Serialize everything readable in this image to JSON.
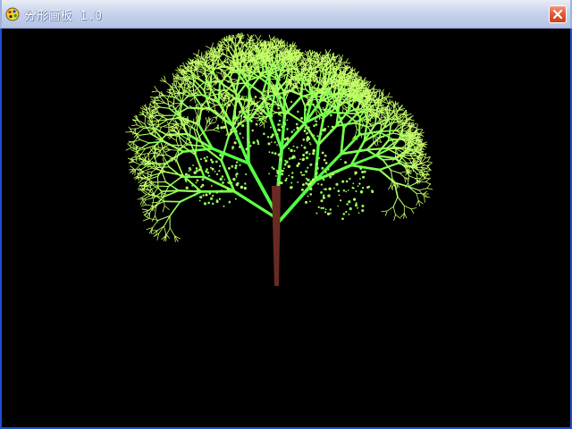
{
  "window": {
    "title": "分形画板 1.0",
    "background_color": "#000000"
  },
  "titlebar": {
    "app_icon": "paint-palette-icon",
    "close_icon": "close-icon"
  },
  "canvas": {
    "content": "fractal-tree",
    "trunk_color": "#6a2a24",
    "foliage_color_start": "#3cff3c",
    "foliage_color_end": "#c8ff6a"
  }
}
